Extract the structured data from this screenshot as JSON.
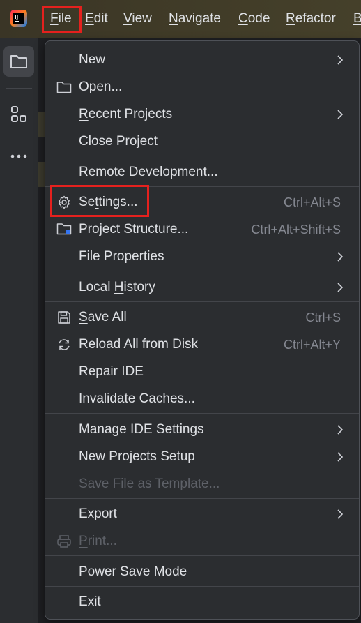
{
  "menubar": {
    "items": [
      {
        "pre": "",
        "u": "F",
        "post": "ile"
      },
      {
        "pre": "",
        "u": "E",
        "post": "dit"
      },
      {
        "pre": "",
        "u": "V",
        "post": "iew"
      },
      {
        "pre": "",
        "u": "N",
        "post": "avigate"
      },
      {
        "pre": "",
        "u": "C",
        "post": "ode"
      },
      {
        "pre": "",
        "u": "R",
        "post": "efactor"
      },
      {
        "pre": "",
        "u": "B",
        "post": ""
      }
    ]
  },
  "logo": {
    "text": "IJ"
  },
  "file_menu": {
    "new": {
      "pre": "",
      "u": "N",
      "post": "ew"
    },
    "open": {
      "pre": "",
      "u": "O",
      "post": "pen..."
    },
    "recent_projects": {
      "pre": "",
      "u": "R",
      "post": "ecent Projects"
    },
    "close_project": {
      "pre": "Close Project",
      "u": "",
      "post": ""
    },
    "remote_development": {
      "pre": "Remote Development...",
      "u": "",
      "post": ""
    },
    "settings": {
      "pre": "Se",
      "u": "t",
      "post": "tings...",
      "shortcut": "Ctrl+Alt+S"
    },
    "project_structure": {
      "pre": "Project Structure...",
      "u": "",
      "post": "",
      "shortcut": "Ctrl+Alt+Shift+S"
    },
    "file_properties": {
      "pre": "File Properties",
      "u": "",
      "post": ""
    },
    "local_history": {
      "pre": "Local ",
      "u": "H",
      "post": "istory"
    },
    "save_all": {
      "pre": "",
      "u": "S",
      "post": "ave All",
      "shortcut": "Ctrl+S"
    },
    "reload_all": {
      "pre": "Reload All from Disk",
      "u": "",
      "post": "",
      "shortcut": "Ctrl+Alt+Y"
    },
    "repair_ide": {
      "pre": "Repair IDE",
      "u": "",
      "post": ""
    },
    "invalidate_caches": {
      "pre": "Invalidate Caches...",
      "u": "",
      "post": ""
    },
    "manage_ide_settings": {
      "pre": "Manage IDE Settings",
      "u": "",
      "post": ""
    },
    "new_projects_setup": {
      "pre": "New Projects Setup",
      "u": "",
      "post": ""
    },
    "save_file_as_template": {
      "pre": "Save File as Temp",
      "u": "l",
      "post": "ate..."
    },
    "export": {
      "pre": "Export",
      "u": "",
      "post": ""
    },
    "print": {
      "pre": "",
      "u": "P",
      "post": "rint..."
    },
    "power_save_mode": {
      "pre": "Power Save Mode",
      "u": "",
      "post": ""
    },
    "exit": {
      "pre": "E",
      "u": "x",
      "post": "it"
    }
  },
  "colors": {
    "highlight": "#e5211e",
    "menu_bg": "#2b2d30",
    "text": "#dfe1e5",
    "shortcut_text": "#858891",
    "disabled_text": "#5e6168"
  }
}
